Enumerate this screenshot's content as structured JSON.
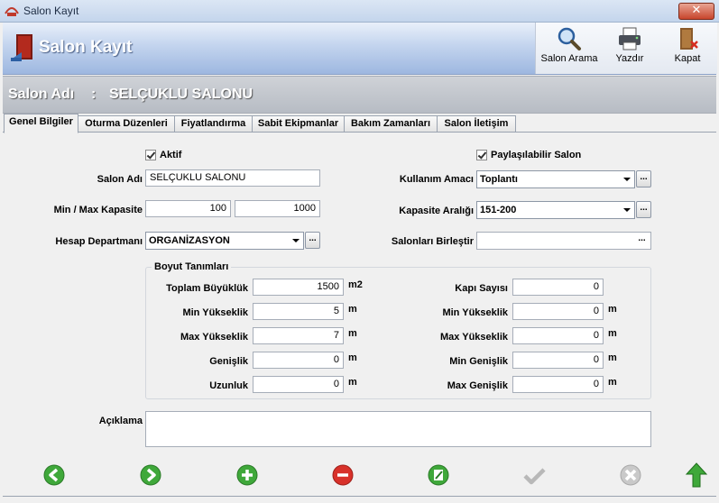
{
  "window": {
    "title": "Salon Kayıt",
    "close_label": "✕"
  },
  "header": {
    "title": "Salon Kayıt"
  },
  "toolbar": {
    "search_label": "Salon Arama",
    "print_label": "Yazdır",
    "close_label": "Kapat"
  },
  "namebar": {
    "label": "Salon Adı",
    "separator": ":",
    "value": "SELÇUKLU SALONU"
  },
  "tabs": [
    {
      "label": "Genel Bilgiler"
    },
    {
      "label": "Oturma Düzenleri"
    },
    {
      "label": "Fiyatlandırma"
    },
    {
      "label": "Sabit Ekipmanlar"
    },
    {
      "label": "Bakım Zamanları"
    },
    {
      "label": "Salon İletişim"
    }
  ],
  "form": {
    "active_label": "Aktif",
    "active_checked": true,
    "shareable_label": "Paylaşılabilir Salon",
    "shareable_checked": true,
    "salon_name_label": "Salon Adı",
    "salon_name_value": "SELÇUKLU SALONU",
    "capacity_label": "Min / Max Kapasite",
    "min_capacity": "100",
    "max_capacity": "1000",
    "department_label": "Hesap Departmanı",
    "department_value": "ORGANİZASYON",
    "usage_label": "Kullanım Amacı",
    "usage_value": "Toplantı",
    "capacity_range_label": "Kapasite Aralığı",
    "capacity_range_value": "151-200",
    "merge_label": "Salonları Birleştir",
    "merge_value": "",
    "dots": "...",
    "description_label": "Açıklama",
    "description_value": ""
  },
  "dimensions": {
    "title": "Boyut Tanımları",
    "left": [
      {
        "label": "Toplam Büyüklük",
        "value": "1500",
        "unit": "m2"
      },
      {
        "label": "Min Yükseklik",
        "value": "5",
        "unit": "m"
      },
      {
        "label": "Max Yükseklik",
        "value": "7",
        "unit": "m"
      },
      {
        "label": "Genişlik",
        "value": "0",
        "unit": "m"
      },
      {
        "label": "Uzunluk",
        "value": "0",
        "unit": "m"
      }
    ],
    "right": [
      {
        "label": "Kapı Sayısı",
        "value": "0",
        "unit": ""
      },
      {
        "label": "Min Yükseklik",
        "value": "0",
        "unit": "m"
      },
      {
        "label": "Max Yükseklik",
        "value": "0",
        "unit": "m"
      },
      {
        "label": "Min Genişlik",
        "value": "0",
        "unit": "m"
      },
      {
        "label": "Max Genişlik",
        "value": "0",
        "unit": "m"
      }
    ]
  },
  "colors": {
    "nav_green": "#3fa83a",
    "delete_red": "#d8312a",
    "disabled_gray": "#b8b8b8"
  }
}
